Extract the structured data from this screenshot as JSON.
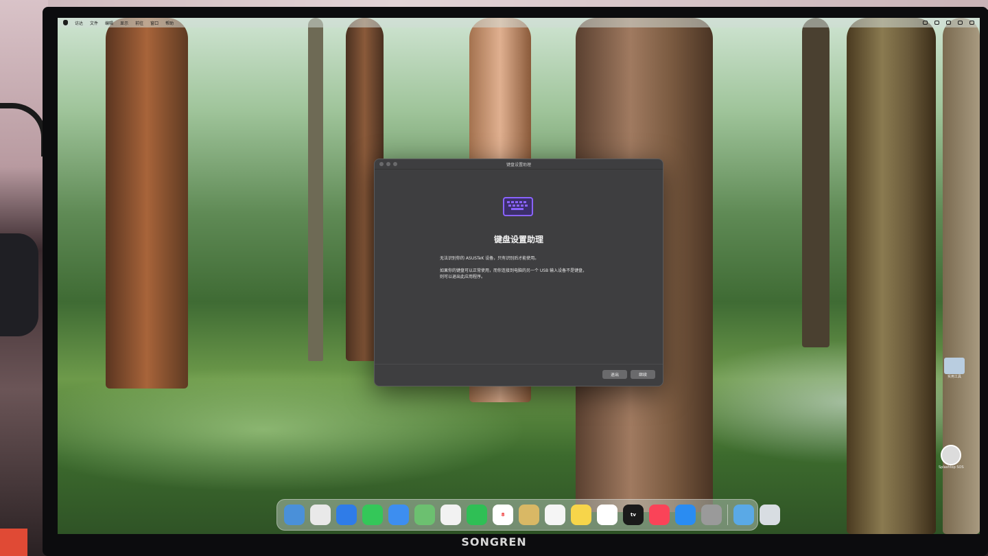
{
  "menubar": {
    "items": [
      "访达",
      "文件",
      "编辑",
      "显示",
      "前往",
      "窗口",
      "帮助"
    ]
  },
  "dialog": {
    "window_title": "键盘设置助理",
    "heading": "键盘设置助理",
    "paragraph1": "无法识别你的 ASUSTeK 设备，只有识别后才能使用。",
    "paragraph2_line1": "如果你的键盘可以正常使用，而你连接到电脑的另一个 USB 输入设备不是键盘，",
    "paragraph2_line2": "则可以退出此应用程序。",
    "quit_label": "退出",
    "continue_label": "继续",
    "accent_color": "#8a63ff"
  },
  "desktop": {
    "folder_label": "实用工具",
    "app_label": "Splashtop SOS"
  },
  "dock": {
    "items": [
      {
        "name": "finder",
        "color": "#4a90d9"
      },
      {
        "name": "launchpad",
        "color": "#e9e9e9"
      },
      {
        "name": "safari",
        "color": "#2f7ce8"
      },
      {
        "name": "messages",
        "color": "#34c759"
      },
      {
        "name": "mail",
        "color": "#3d8ef0"
      },
      {
        "name": "maps",
        "color": "#6cc070"
      },
      {
        "name": "photos",
        "color": "#f2f2f2"
      },
      {
        "name": "facetime",
        "color": "#2fbf55"
      },
      {
        "name": "calendar",
        "color": "#ffffff",
        "text": "8"
      },
      {
        "name": "notes-folder",
        "color": "#d9b865"
      },
      {
        "name": "reminders",
        "color": "#f5f5f5"
      },
      {
        "name": "notes",
        "color": "#f7d54a"
      },
      {
        "name": "freeform",
        "color": "#ffffff"
      },
      {
        "name": "apple-tv",
        "color": "#1a1a1a",
        "text": "tv"
      },
      {
        "name": "music",
        "color": "#fa4358"
      },
      {
        "name": "app-store",
        "color": "#2a8cf2"
      },
      {
        "name": "system-settings",
        "color": "#9a9a9a"
      }
    ],
    "trailing": [
      {
        "name": "downloads-folder",
        "color": "#5aa9e6"
      },
      {
        "name": "trash",
        "color": "#d8dde2"
      }
    ]
  },
  "monitor_brand": "SONGREN"
}
